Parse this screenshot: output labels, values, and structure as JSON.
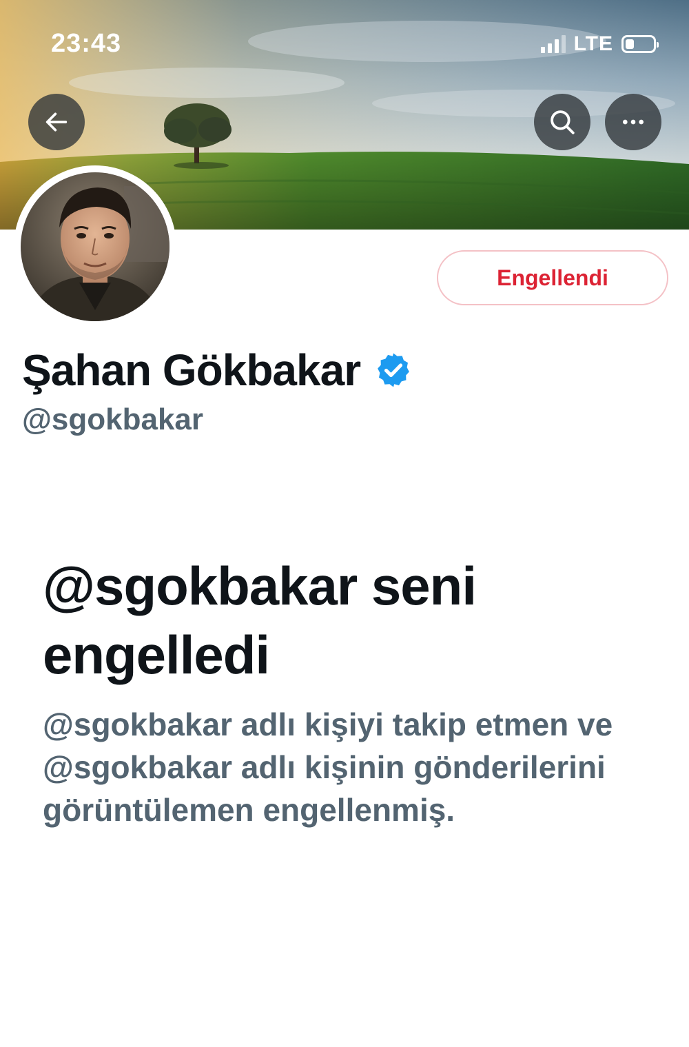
{
  "status_bar": {
    "time": "23:43",
    "network": "LTE",
    "signal_bars": 3,
    "battery_level": 0.25
  },
  "header": {
    "back_icon": "arrow-left-icon",
    "search_icon": "search-icon",
    "more_icon": "more-horizontal-icon"
  },
  "profile": {
    "display_name": "Şahan Gökbakar",
    "handle": "@sgokbakar",
    "verified": true,
    "verified_color": "#1d9bf0",
    "blocked_button_label": "Engellendi",
    "blocked_button_color": "#dc2334"
  },
  "blocked_notice": {
    "title": "@sgokbakar seni engelledi",
    "description": "@sgokbakar adlı kişiyi takip etmen ve @sgokbakar adlı kişinin gönderilerini görüntülemen engellenmiş."
  },
  "colors": {
    "primary_text": "#0f1419",
    "secondary_text": "#536471",
    "background": "#ffffff"
  }
}
